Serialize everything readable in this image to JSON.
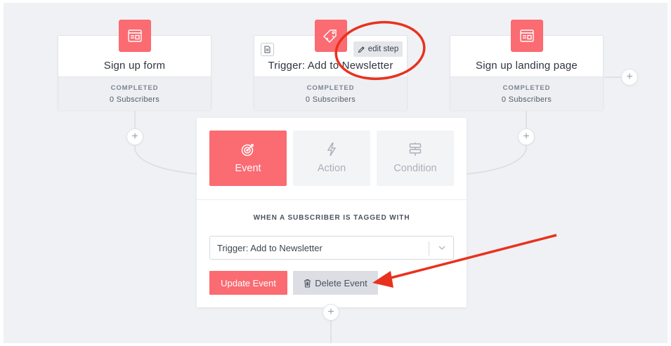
{
  "colors": {
    "accent": "#fb6b72",
    "canvas": "#f0f1f4",
    "annotation": "#e8321e"
  },
  "nodes": [
    {
      "title": "Sign up form",
      "status": "COMPLETED",
      "subscribers": "0 Subscribers",
      "icon": "form-window-icon"
    },
    {
      "title": "Trigger: Add to Newsletter",
      "status": "COMPLETED",
      "subscribers": "0 Subscribers",
      "icon": "tag-icon"
    },
    {
      "title": "Sign up landing page",
      "status": "COMPLETED",
      "subscribers": "0 Subscribers",
      "icon": "form-window-icon"
    }
  ],
  "edit_step": {
    "label": "edit step",
    "icon": "pencil-icon"
  },
  "add_step": {
    "symbol": "+"
  },
  "panel": {
    "tabs": [
      {
        "label": "Event",
        "icon": "target-icon",
        "active": true
      },
      {
        "label": "Action",
        "icon": "lightning-icon",
        "active": false
      },
      {
        "label": "Condition",
        "icon": "signpost-icon",
        "active": false
      }
    ],
    "heading": "WHEN A SUBSCRIBER IS TAGGED WITH",
    "select_value": "Trigger: Add to Newsletter",
    "update_label": "Update Event",
    "delete_label": "Delete Event"
  }
}
